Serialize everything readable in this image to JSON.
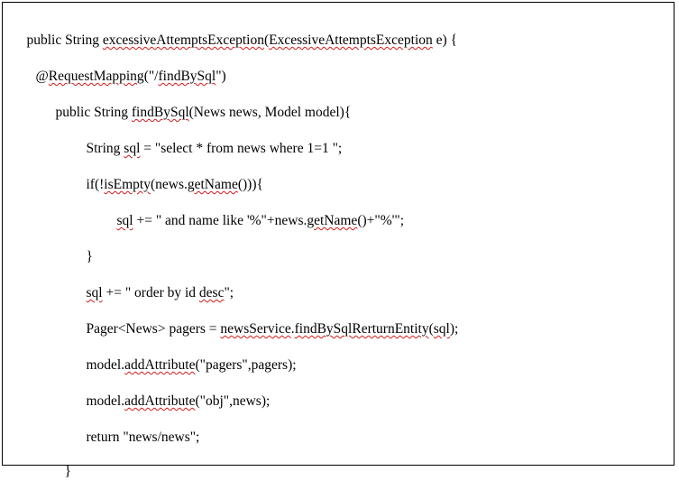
{
  "document": {
    "lines": [
      [
        {
          "t": "public String "
        },
        {
          "t": "excessiveAttemptsException",
          "err": true
        },
        {
          "t": "("
        },
        {
          "t": "ExcessiveAttemptsException",
          "err": true
        },
        {
          "t": " e) {"
        }
      ],
      [
        {
          "t": "@"
        },
        {
          "t": "RequestMapping",
          "err": true
        },
        {
          "t": "(\"/"
        },
        {
          "t": "findBySql",
          "err": true
        },
        {
          "t": "\")"
        }
      ],
      [
        {
          "t": "public String "
        },
        {
          "t": "findBySql",
          "err": true
        },
        {
          "t": "(News news, Model model){"
        }
      ],
      [
        {
          "t": "String "
        },
        {
          "t": "sql",
          "err": true
        },
        {
          "t": " = \"select * from news where 1=1 \";"
        }
      ],
      [
        {
          "t": "if(!"
        },
        {
          "t": "isEmpty",
          "err": true
        },
        {
          "t": "(news."
        },
        {
          "t": "getName",
          "err": true
        },
        {
          "t": "())){"
        }
      ],
      [
        {
          "t": "sql",
          "err": true
        },
        {
          "t": " += \" and name like '%\"+news."
        },
        {
          "t": "getName",
          "err": true
        },
        {
          "t": "()+\"%'\";"
        }
      ],
      [
        {
          "t": "}"
        }
      ],
      [
        {
          "t": "sql",
          "err": true
        },
        {
          "t": " += \" order by id "
        },
        {
          "t": "desc",
          "err": true
        },
        {
          "t": "\";"
        }
      ],
      [
        {
          "t": "Pager<News> pagers = "
        },
        {
          "t": "newsService",
          "err": true
        },
        {
          "t": "."
        },
        {
          "t": "findBySqlRerturnEntity",
          "err": true
        },
        {
          "t": "("
        },
        {
          "t": "sql",
          "err": true
        },
        {
          "t": ");"
        }
      ],
      [
        {
          "t": "model."
        },
        {
          "t": "addAttribute",
          "err": true
        },
        {
          "t": "(\"pagers\",pagers);"
        }
      ],
      [
        {
          "t": "model."
        },
        {
          "t": "addAttribute",
          "err": true
        },
        {
          "t": "(\"obj\",news);"
        }
      ],
      [
        {
          "t": "return \"news/news\";"
        }
      ],
      [
        {
          "t": "}"
        }
      ]
    ]
  },
  "colors": {
    "text": "#000000",
    "spellcheck_underline": "#d21a1a",
    "border": "#000000",
    "background": "#ffffff"
  }
}
